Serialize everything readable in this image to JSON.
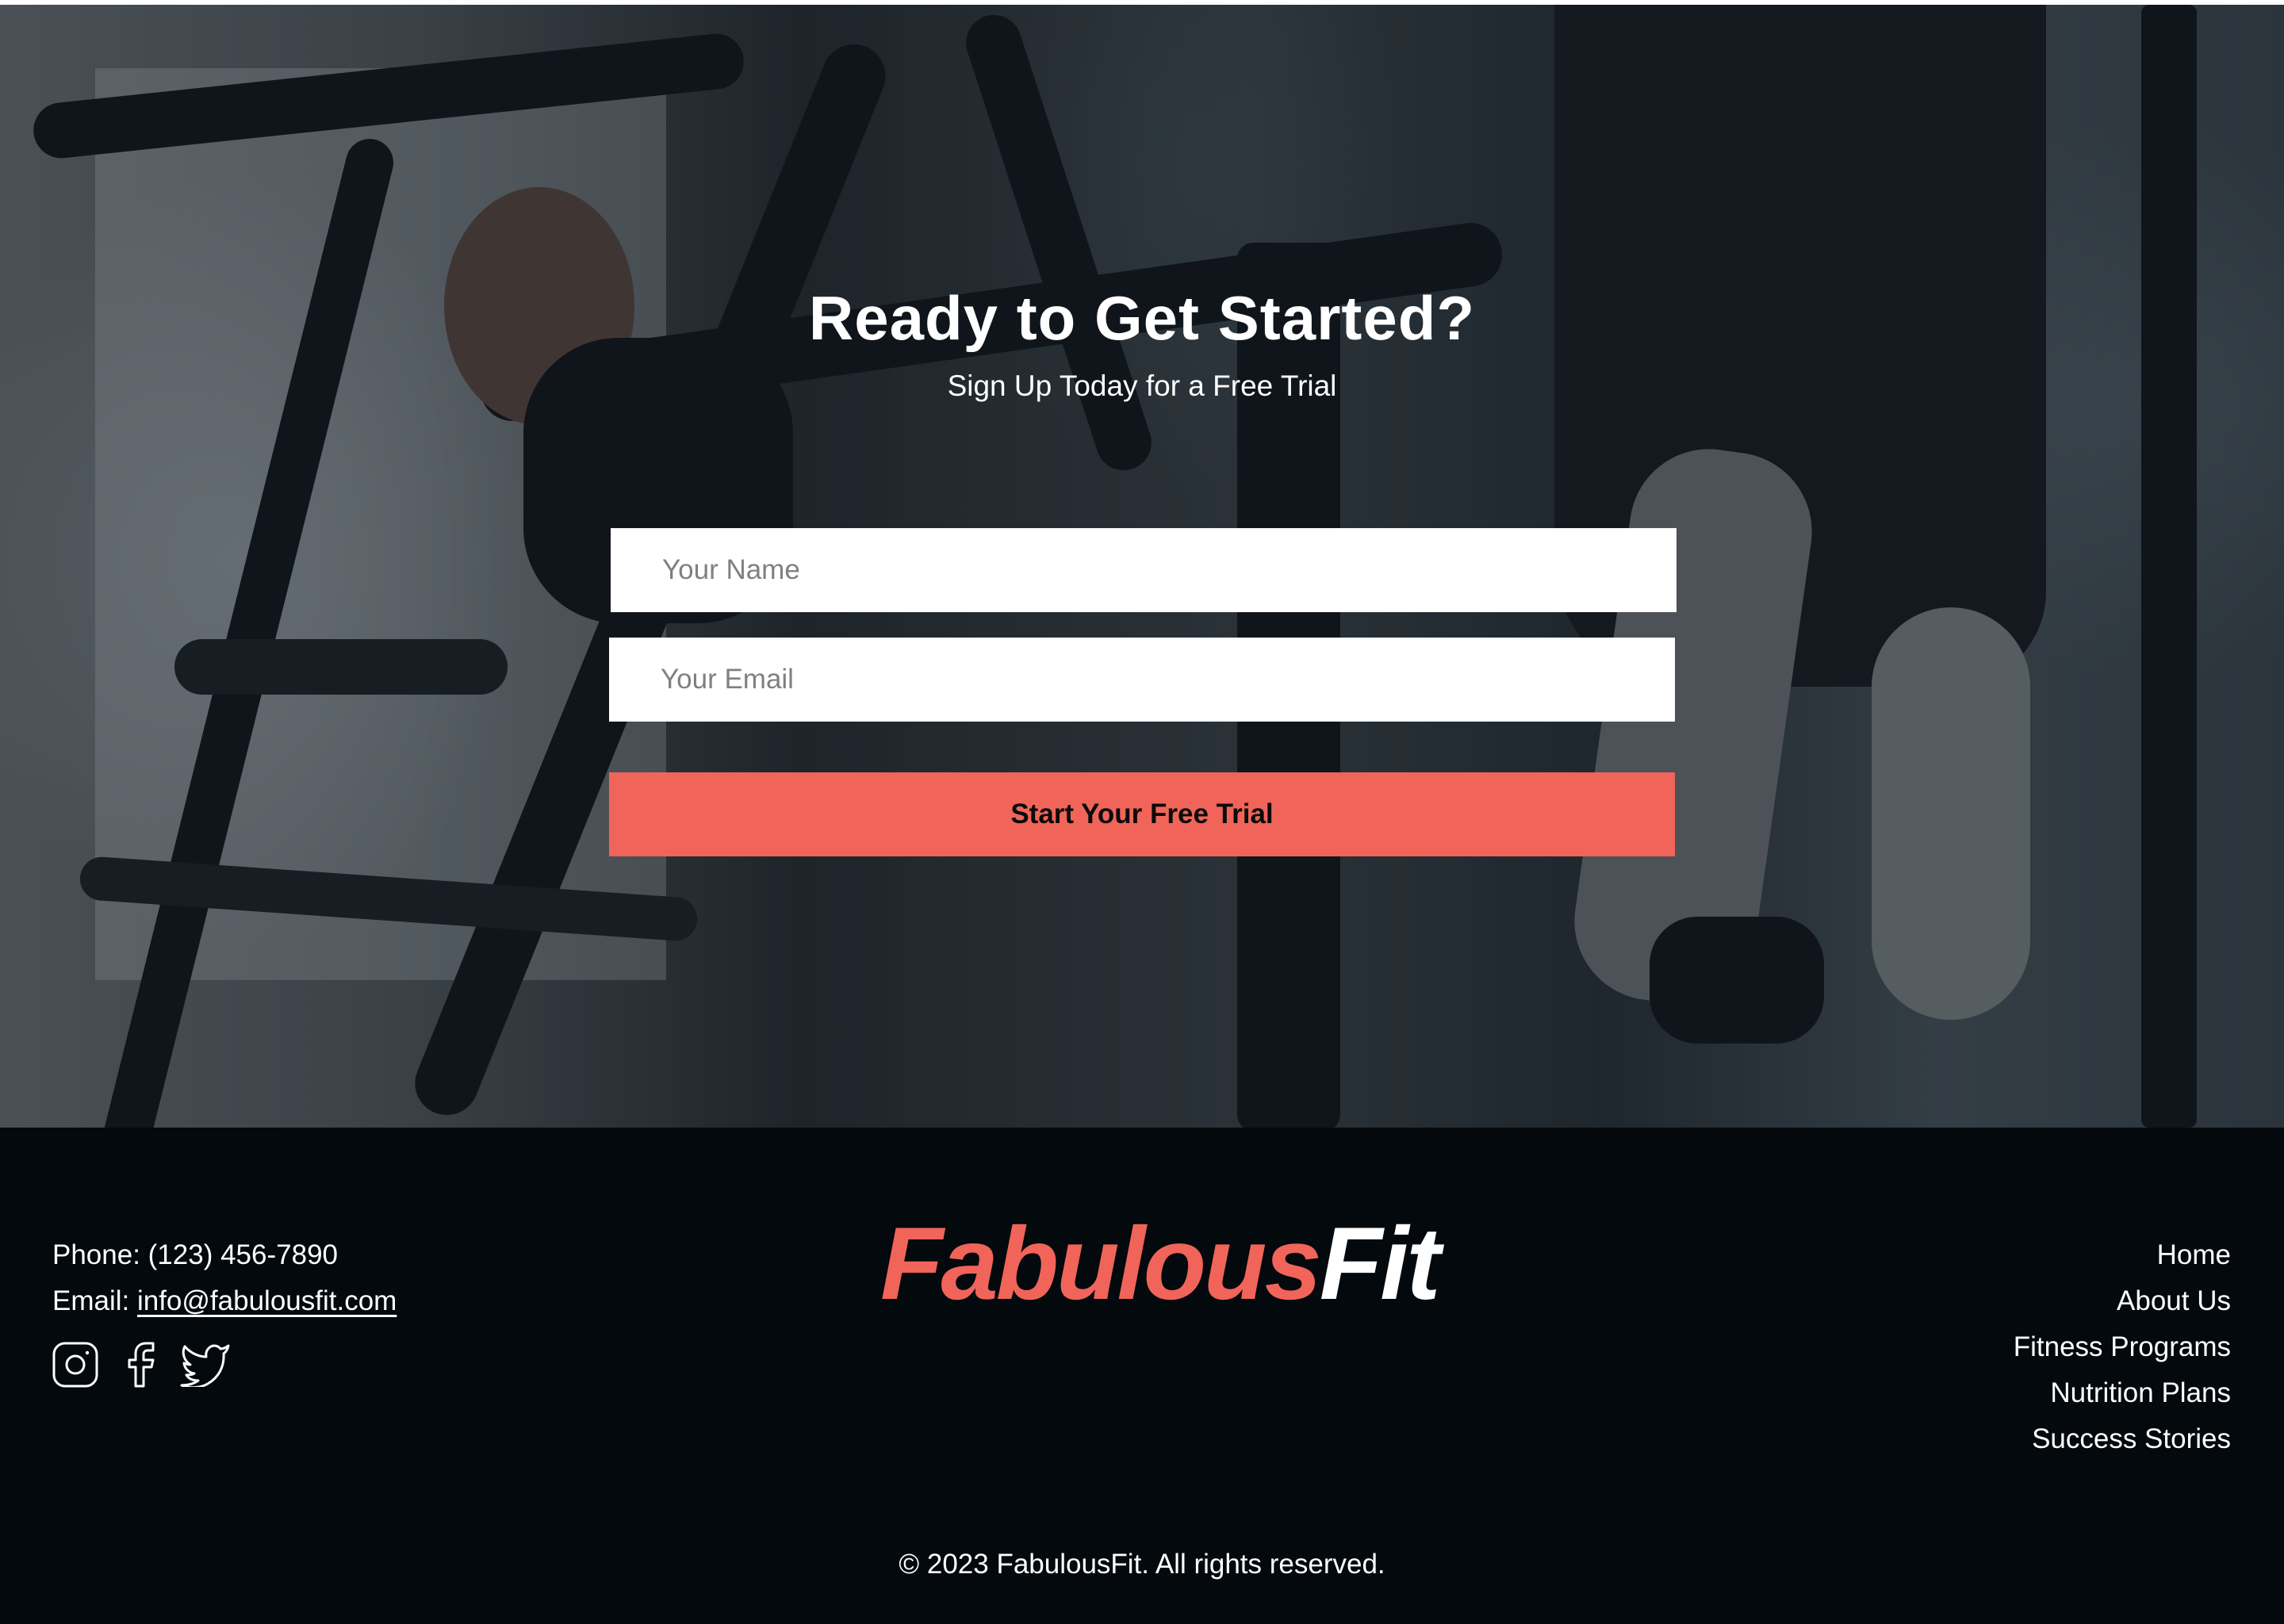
{
  "hero": {
    "title": "Ready to Get Started?",
    "subtitle": "Sign Up Today for a Free Trial",
    "background_image": "gym-treadmill-workout-photo"
  },
  "form": {
    "name_placeholder": "Your Name",
    "name_value": "",
    "email_placeholder": "Your Email",
    "email_value": "",
    "submit_label": "Start Your Free Trial"
  },
  "footer": {
    "contact": {
      "phone_label": "Phone: ",
      "phone": "(123) 456-7890",
      "email_label": "Email: ",
      "email": "info@fabulousfit.com"
    },
    "social": [
      {
        "name": "instagram",
        "icon": "instagram-icon"
      },
      {
        "name": "facebook",
        "icon": "facebook-icon"
      },
      {
        "name": "twitter",
        "icon": "twitter-icon"
      }
    ],
    "logo": {
      "part1": "Fabulous",
      "part2": "Fit"
    },
    "nav": [
      {
        "label": "Home"
      },
      {
        "label": "About Us"
      },
      {
        "label": "Fitness Programs"
      },
      {
        "label": "Nutrition Plans"
      },
      {
        "label": "Success Stories"
      }
    ],
    "copyright": "© 2023 FabulousFit. All rights reserved."
  },
  "colors": {
    "accent": "#f16459",
    "footer_bg": "#03090d",
    "text_light": "#ffffff",
    "button_text": "#0b0b0b",
    "placeholder": "#808080"
  }
}
